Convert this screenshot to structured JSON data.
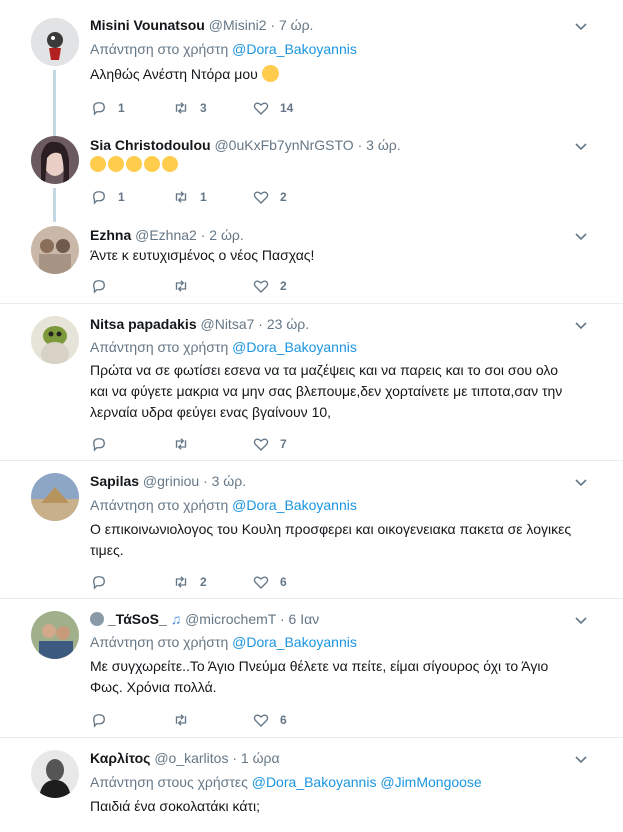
{
  "tweets": [
    {
      "name": "Misini Vounatsou",
      "handle": "@Misini2",
      "time": "7 ώρ.",
      "reply_prefix": "Απάντηση στο χρήστη",
      "reply_to": "@Dora_Bakoyannis",
      "reply_to2": "",
      "text": "Αληθώς Ανέστη Ντόρα μου",
      "replies": "1",
      "retweets": "3",
      "likes": "14",
      "avatar_color": "#cfd3d6"
    },
    {
      "name": "Sia Christodoulou",
      "handle": "@0uKxFb7ynNrGSTO",
      "time": "3 ώρ.",
      "reply_prefix": "",
      "reply_to": "",
      "reply_to2": "",
      "text": "",
      "replies": "1",
      "retweets": "1",
      "likes": "2",
      "avatar_color": "#5a4a4f"
    },
    {
      "name": "Ezhna",
      "handle": "@Ezhna2",
      "time": "2 ώρ.",
      "reply_prefix": "",
      "reply_to": "",
      "reply_to2": "",
      "text": "Άντε κ ευτυχισμένος ο νέος Πασχας!",
      "replies": "",
      "retweets": "",
      "likes": "2",
      "avatar_color": "#b8a89a"
    },
    {
      "name": "Nitsa papadakis",
      "handle": "@Nitsa7",
      "time": "23 ώρ.",
      "reply_prefix": "Απάντηση στο χρήστη",
      "reply_to": "@Dora_Bakoyannis",
      "reply_to2": "",
      "text_lines": [
        "Πρώτα να σε φωτίσει εσενα να τα μαζέψεις  και να παρεις και το σοι σου ολο",
        "και να φύγετε μακρια να μην σας βλεπουμε,δεν χορταίνετε με τιποτα,σαν την",
        "λερναία υδρα φεύγει ενας βγαίνουν 10,"
      ],
      "replies": "",
      "retweets": "",
      "likes": "7",
      "avatar_color": "#8f9a6a"
    },
    {
      "name": "Sapilas",
      "handle": "@griniou",
      "time": "3 ώρ.",
      "reply_prefix": "Απάντηση στο χρήστη",
      "reply_to": "@Dora_Bakoyannis",
      "reply_to2": "",
      "text_lines": [
        "Ο επικοινωνιολογος του Κουλη  προσφερει και οικογενειακα πακετα σε λογικες",
        "τιμες."
      ],
      "replies": "",
      "retweets": "2",
      "likes": "6",
      "avatar_color": "#7d8fa8"
    },
    {
      "name": "_ΤάSoS_",
      "handle": "@microchemT",
      "time": "6 Ιαν",
      "reply_prefix": "Απάντηση στο χρήστη",
      "reply_to": "@Dora_Bakoyannis",
      "reply_to2": "",
      "text_lines": [
        "Με συγχωρείτε..Το Άγιο Πνεύμα θέλετε να πείτε, είμαι σίγουρος όχι το Άγιο",
        "Φως. Χρόνια πολλά."
      ],
      "replies": "",
      "retweets": "",
      "likes": "6",
      "avatar_color": "#6f7f5f"
    },
    {
      "name": "Καρλίτος",
      "handle": "@o_karlitos",
      "time": "1 ώρα",
      "reply_prefix": "Απάντηση στους χρήστες",
      "reply_to": "@Dora_Bakoyannis",
      "reply_to2": "@JimMongoose",
      "text": "Παιδιά ένα σοκολατάκι κάτι;",
      "avatar_color": "#2a2a2a"
    }
  ],
  "colors": {
    "link": "#1b95e0",
    "muted": "#657786",
    "separator": "#e6ecf0",
    "thread": "#c5d7e3"
  },
  "icons": [
    "reply-icon",
    "retweet-icon",
    "like-icon",
    "chevron-down-icon",
    "emoji-icon"
  ]
}
